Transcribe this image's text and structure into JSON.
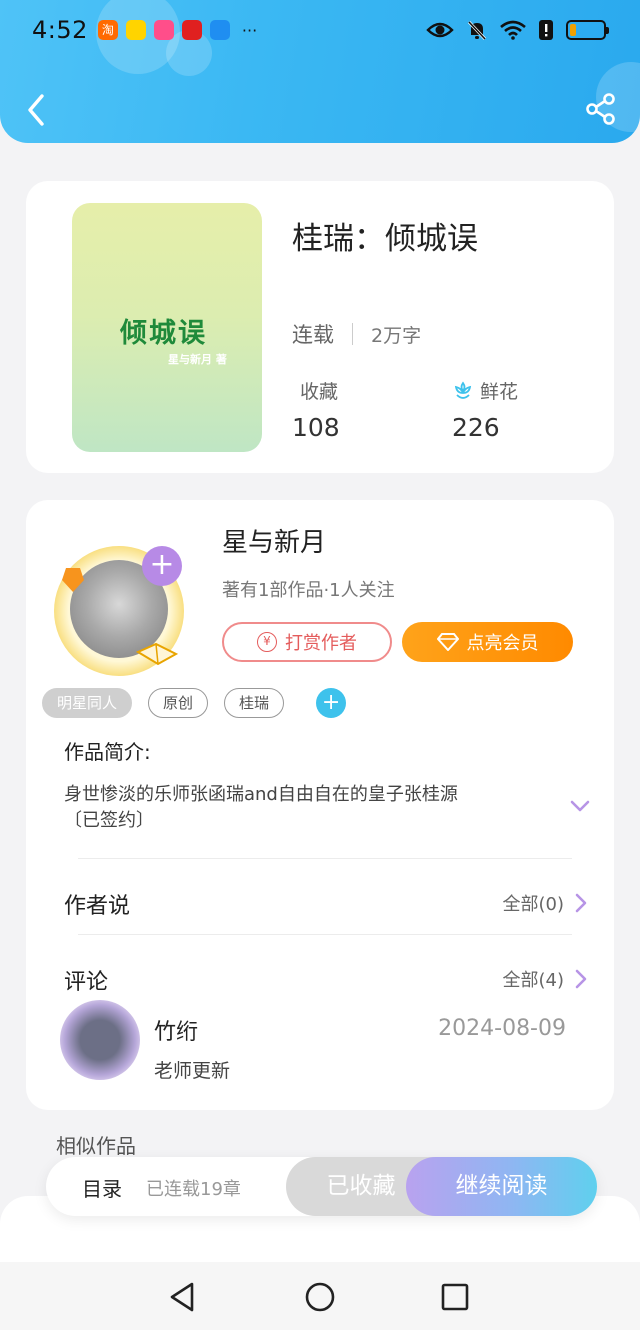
{
  "status_bar": {
    "time": "4:52",
    "dots": "···",
    "battery_level": 0.2,
    "app_icons": [
      {
        "name": "taobao-icon",
        "color": "#ff6a00",
        "glyph": "淘"
      },
      {
        "name": "app-icon-2",
        "color": "#ffd400",
        "glyph": ""
      },
      {
        "name": "app-icon-3",
        "color": "#ff4e8a",
        "glyph": ""
      },
      {
        "name": "huawei-icon",
        "color": "#e02020",
        "glyph": ""
      },
      {
        "name": "app-icon-5",
        "color": "#1f8ef1",
        "glyph": ""
      }
    ]
  },
  "header": {
    "colors": {
      "start": "#4fc3f7",
      "end": "#2aa9ee"
    }
  },
  "book": {
    "cover_title": "倾城误",
    "cover_subtitle": "星与新月 著",
    "title": "桂瑞：倾城误",
    "status": "连载",
    "word_count": "2万字",
    "favorites_label": "收藏",
    "favorites_value": "108",
    "flowers_label": "鲜花",
    "flowers_value": "226"
  },
  "author": {
    "name": "星与新月",
    "info": "著有1部作品·1人关注",
    "follow_label": "+",
    "reward_label": "打赏作者",
    "vip_label": "点亮会员"
  },
  "tags": [
    "明星同人",
    "原创",
    "桂瑞"
  ],
  "tag_add": "+",
  "intro": {
    "heading": "作品简介:",
    "text_line1": "身世惨淡的乐师张函瑞and自由自在的皇子张桂源",
    "text_line2": "〔已签约〕"
  },
  "author_says": {
    "title": "作者说",
    "link": "全部(0)"
  },
  "comments": {
    "title": "评论",
    "link": "全部(4)",
    "items": [
      {
        "user": "竹绗",
        "date": "2024-08-09",
        "text": "老师更新"
      }
    ]
  },
  "similar_title": "相似作品",
  "action_bar": {
    "toc_label": "目录",
    "toc_count": "已连载19章",
    "favorited_label": "已收藏",
    "read_label": "继续阅读"
  }
}
